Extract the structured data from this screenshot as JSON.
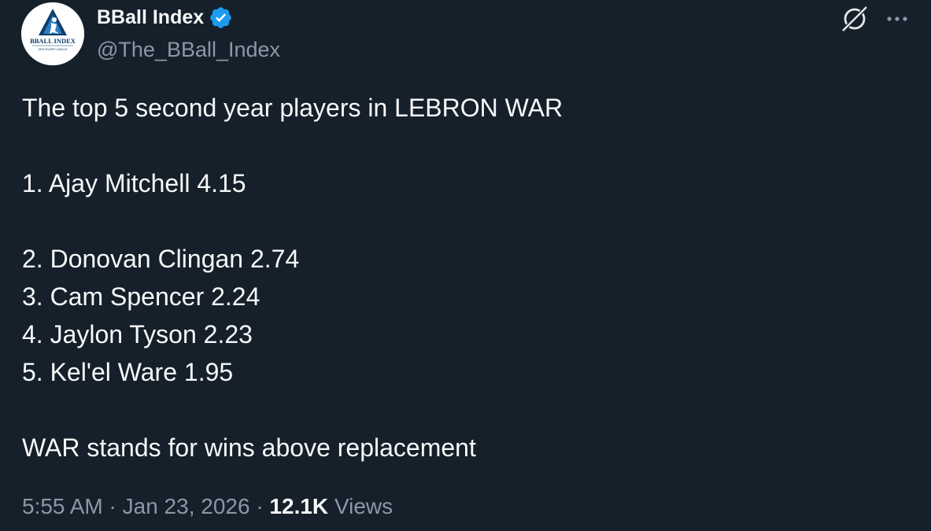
{
  "author": {
    "name": "BBall Index",
    "handle": "@The_BBall_Index",
    "avatar": {
      "wordmark": "BBALL INDEX",
      "tagline": "SEE EVERY ANGLE"
    }
  },
  "icons": {
    "verified": "verified-badge-icon",
    "grok": "grok-icon",
    "more": "more-options-icon"
  },
  "tweet": {
    "lines": {
      "intro": "The top 5 second year players in LEBRON WAR",
      "item1": "1. Ajay Mitchell 4.15",
      "item2": "2. Donovan Clingan 2.74",
      "item3": "3. Cam Spencer 2.24",
      "item4": "4. Jaylon Tyson 2.23",
      "item5": "5. Kel'el Ware 1.95",
      "footnote": "WAR stands for wins above replacement"
    }
  },
  "meta": {
    "time": "5:55 AM",
    "separator": " · ",
    "date": "Jan 23, 2026",
    "views_count": "12.1K",
    "views_label": "Views"
  },
  "colors": {
    "background": "#15202b",
    "text_primary": "#f7f9f9",
    "text_secondary": "#8b98a5",
    "verified_blue": "#1d9bf0"
  }
}
